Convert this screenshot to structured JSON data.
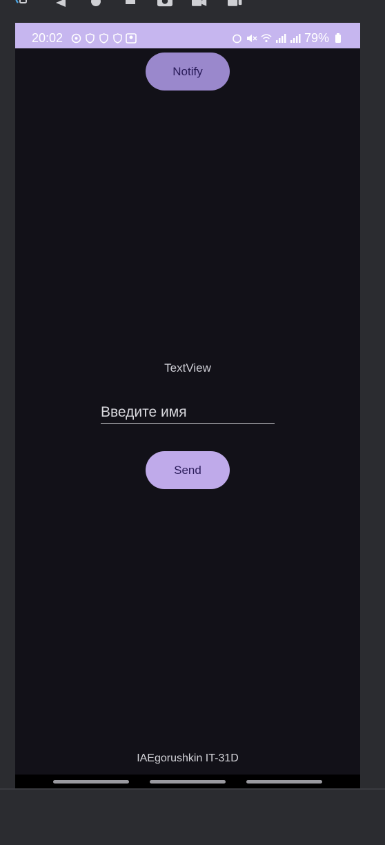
{
  "status_bar": {
    "time": "20:02",
    "battery_text": "79%",
    "left_icons": [
      "notification-icon",
      "shield-icon",
      "shield-icon",
      "shield-icon",
      "gallery-icon"
    ],
    "right_icons": [
      "alarm-icon",
      "mute-icon",
      "wifi-icon",
      "signal-icon",
      "signal-icon",
      "battery-icon"
    ]
  },
  "main": {
    "notify_label": "Notify",
    "textview_text": "TextView",
    "name_placeholder": "Введите имя",
    "name_value": "",
    "send_label": "Send",
    "footer_text": "IAEgorushkin IT-31D"
  },
  "colors": {
    "status_bar": "#c6b6ef",
    "screen_bg": "#121118",
    "notify_button": "#9a88cc",
    "send_button": "#bfaaea",
    "button_text": "#2a1c5a"
  }
}
